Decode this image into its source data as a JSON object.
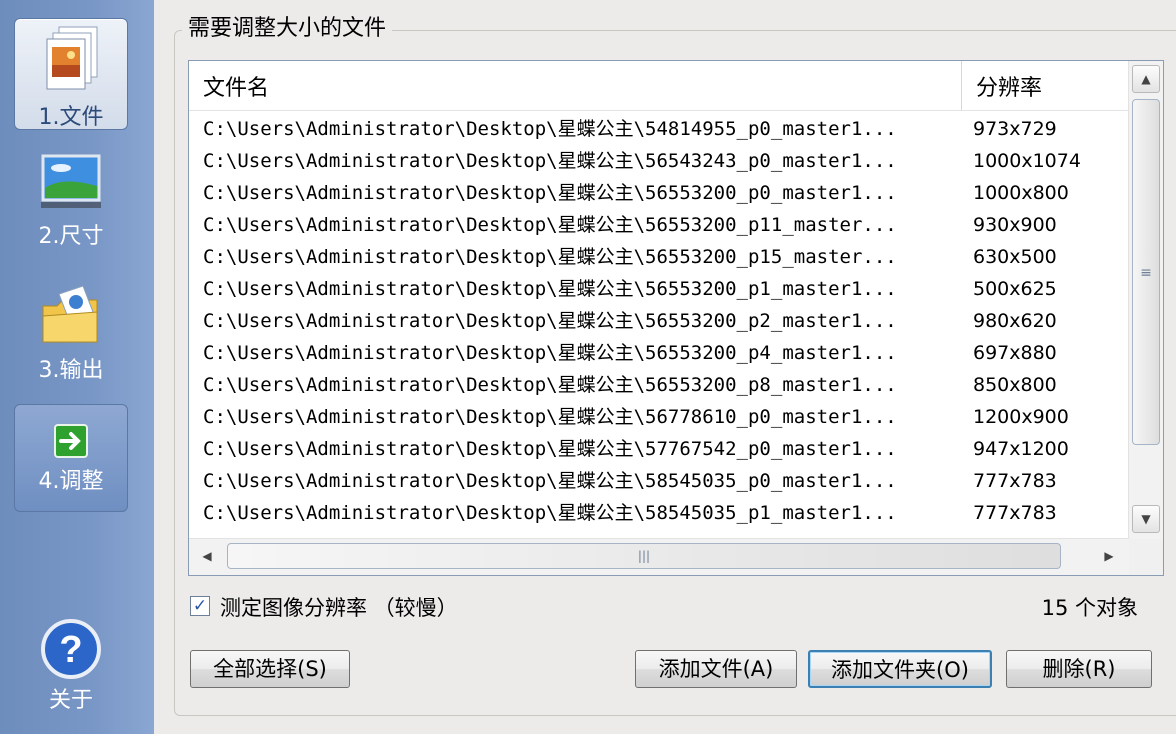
{
  "sidebar": {
    "steps": [
      {
        "label": "1.文件",
        "active": true
      },
      {
        "label": "2.尺寸",
        "active": false
      },
      {
        "label": "3.输出",
        "active": false
      },
      {
        "label": "4.调整",
        "active": false
      }
    ],
    "about_label": "关于"
  },
  "group_title": "需要调整大小的文件",
  "list": {
    "columns": [
      "文件名",
      "分辨率"
    ],
    "rows": [
      {
        "name": "C:\\Users\\Administrator\\Desktop\\星蝶公主\\54814955_p0_master1...",
        "res": "973x729"
      },
      {
        "name": "C:\\Users\\Administrator\\Desktop\\星蝶公主\\56543243_p0_master1...",
        "res": "1000x1074"
      },
      {
        "name": "C:\\Users\\Administrator\\Desktop\\星蝶公主\\56553200_p0_master1...",
        "res": "1000x800"
      },
      {
        "name": "C:\\Users\\Administrator\\Desktop\\星蝶公主\\56553200_p11_master...",
        "res": "930x900"
      },
      {
        "name": "C:\\Users\\Administrator\\Desktop\\星蝶公主\\56553200_p15_master...",
        "res": "630x500"
      },
      {
        "name": "C:\\Users\\Administrator\\Desktop\\星蝶公主\\56553200_p1_master1...",
        "res": "500x625"
      },
      {
        "name": "C:\\Users\\Administrator\\Desktop\\星蝶公主\\56553200_p2_master1...",
        "res": "980x620"
      },
      {
        "name": "C:\\Users\\Administrator\\Desktop\\星蝶公主\\56553200_p4_master1...",
        "res": "697x880"
      },
      {
        "name": "C:\\Users\\Administrator\\Desktop\\星蝶公主\\56553200_p8_master1...",
        "res": "850x800"
      },
      {
        "name": "C:\\Users\\Administrator\\Desktop\\星蝶公主\\56778610_p0_master1...",
        "res": "1200x900"
      },
      {
        "name": "C:\\Users\\Administrator\\Desktop\\星蝶公主\\57767542_p0_master1...",
        "res": "947x1200"
      },
      {
        "name": "C:\\Users\\Administrator\\Desktop\\星蝶公主\\58545035_p0_master1...",
        "res": "777x783"
      },
      {
        "name": "C:\\Users\\Administrator\\Desktop\\星蝶公主\\58545035_p1_master1...",
        "res": "777x783"
      }
    ]
  },
  "checkbox": {
    "label": "测定图像分辨率 （较慢）",
    "checked": true,
    "mark": "✓"
  },
  "object_count": "15 个对象",
  "buttons": {
    "select_all": "全部选择(S)",
    "add_file": "添加文件(A)",
    "add_folder": "添加文件夹(O)",
    "delete": "删除(R)"
  },
  "scrollbar_glyphs": {
    "up": "▲",
    "down": "▼",
    "left": "◀",
    "right": "▶",
    "grip_h": "|||",
    "grip_v": "≡"
  },
  "colors": {
    "sidebar": "#7997c6",
    "accent_focus": "#3c7fb1",
    "check": "#2a57a8"
  }
}
